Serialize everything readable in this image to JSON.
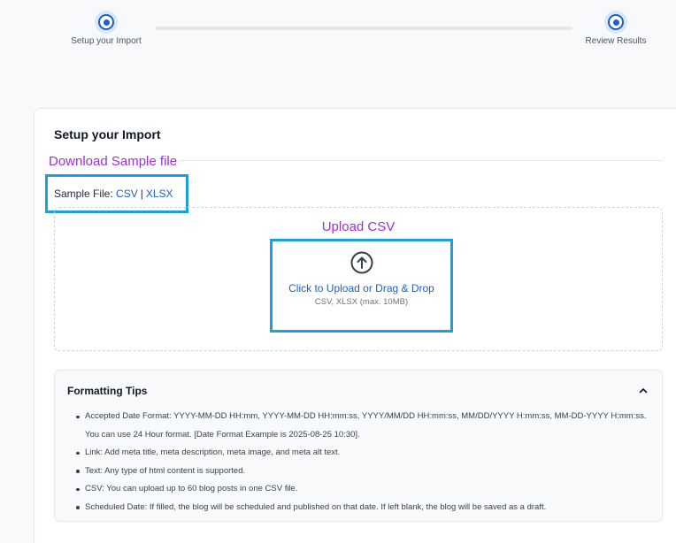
{
  "stepper": {
    "steps": [
      {
        "label": "Setup your Import"
      },
      {
        "label": "Review Results"
      }
    ]
  },
  "card": {
    "title": "Setup your Import",
    "download_label": "Download Sample file",
    "sample": {
      "label": "Sample File:",
      "csv_link": "CSV",
      "separator": "|",
      "xlsx_link": "XLSX"
    },
    "upload": {
      "title": "Upload CSV",
      "cta": "Click to Upload or Drag & Drop",
      "hint": "CSV, XLSX (max. 10MB)",
      "icon": "upload-arrow-icon"
    },
    "tips": {
      "header": "Formatting Tips",
      "toggle_icon": "chevron-up-icon",
      "items": [
        "Accepted Date Format: YYYY-MM-DD HH:mm, YYYY-MM-DD HH:mm:ss, YYYY/MM/DD HH:mm:ss, MM/DD/YYYY H:mm:ss, MM-DD-YYYY H:mm:ss. You can use 24 Hour format. [Date Format Example is 2025-08-25 10:30].",
        "Link: Add meta title, meta description, meta image, and meta alt text.",
        "Text: Any type of html content is supported.",
        "CSV: You can upload up to 60 blog posts in one CSV file.",
        "Scheduled Date: If filled, the blog will be scheduled and published on that date. If left blank, the blog will be saved as a draft."
      ]
    }
  },
  "colors": {
    "accent_blue": "#1f5fc4",
    "highlight_border": "#1a9fe0",
    "annotation_purple": "#9b30d9"
  }
}
